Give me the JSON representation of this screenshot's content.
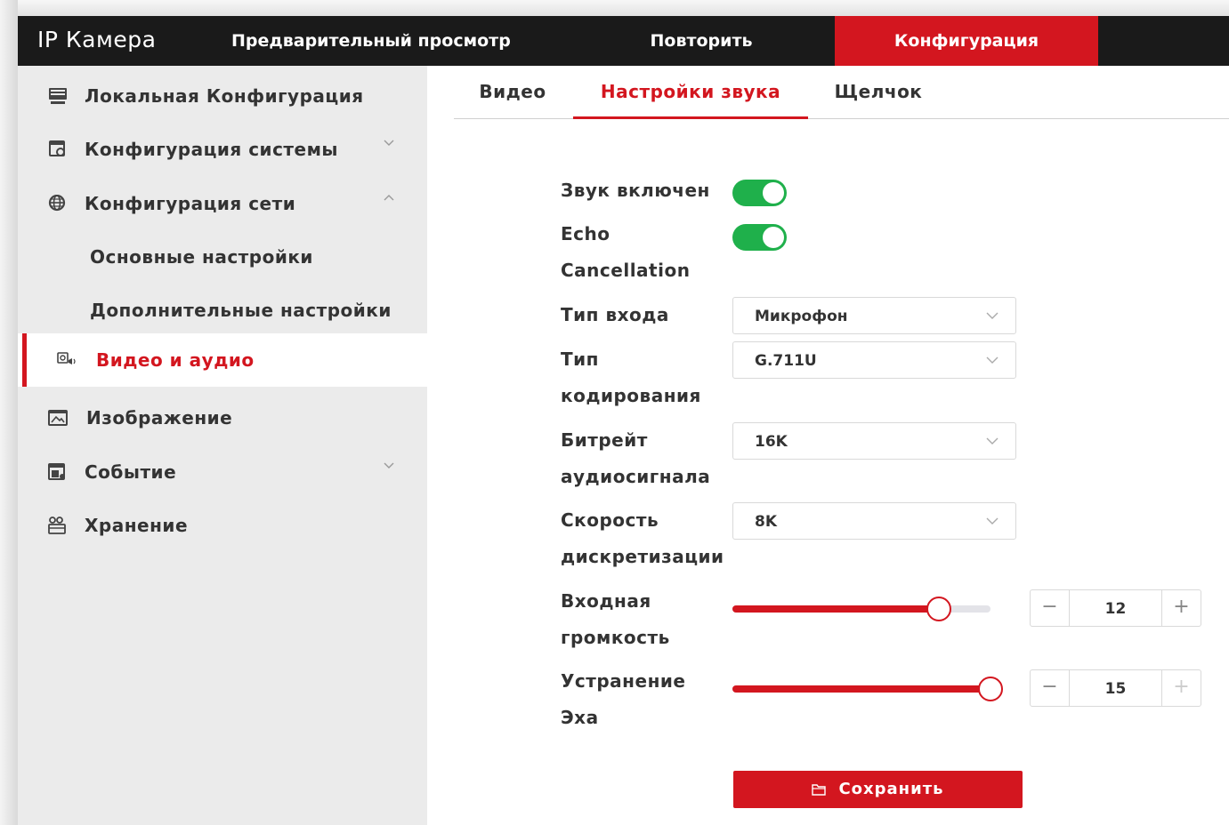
{
  "app": {
    "title": "IP Камера"
  },
  "topnav": {
    "preview": "Предварительный просмотр",
    "playback": "Повторить",
    "config": "Конфигурация"
  },
  "sidebar": {
    "items": [
      {
        "label": "Локальная Конфигурация",
        "icon": "monitor-icon"
      },
      {
        "label": "Конфигурация системы",
        "icon": "system-settings-icon"
      },
      {
        "label": "Конфигурация сети",
        "icon": "globe-icon"
      },
      {
        "label": "Основные настройки"
      },
      {
        "label": "Дополнительные настройки"
      },
      {
        "label": "Видео и аудио",
        "icon": "video-audio-icon",
        "active": true
      },
      {
        "label": "Изображение",
        "icon": "image-icon"
      },
      {
        "label": "Событие",
        "icon": "event-icon"
      },
      {
        "label": "Хранение",
        "icon": "storage-icon"
      }
    ]
  },
  "tabs": {
    "video": "Видео",
    "audio": "Настройки звука",
    "click": "Щелчок"
  },
  "form": {
    "audio_enabled": {
      "label": "Звук включен",
      "on": true
    },
    "echo_cancel": {
      "label_1": "Echo",
      "label_2": "Cancellation",
      "on": true
    },
    "input_type": {
      "label": "Тип входа",
      "value": "Микрофон"
    },
    "encoding": {
      "label_1": "Тип",
      "label_2": "кодирования",
      "value": "G.711U"
    },
    "bitrate": {
      "label_1": "Битрейт",
      "label_2": "аудиосигнала",
      "value": "16K"
    },
    "sample_rate": {
      "label_1": "Скорость",
      "label_2": "дискретизации",
      "value": "8K"
    },
    "input_volume": {
      "label_1": "Входная",
      "label_2": "громкость",
      "value": "12",
      "min": 0,
      "max": 15
    },
    "echo_removal": {
      "label_1": "Устранение",
      "label_2": "Эха",
      "value": "15",
      "min": 0,
      "max": 15
    },
    "minus": "−",
    "plus": "+"
  },
  "save_button": {
    "label": "Сохранить"
  },
  "colors": {
    "accent": "#d3161f",
    "toggle_on": "#1fb04b",
    "topbar": "#1a1a1a",
    "sidebar": "#ebebeb"
  }
}
